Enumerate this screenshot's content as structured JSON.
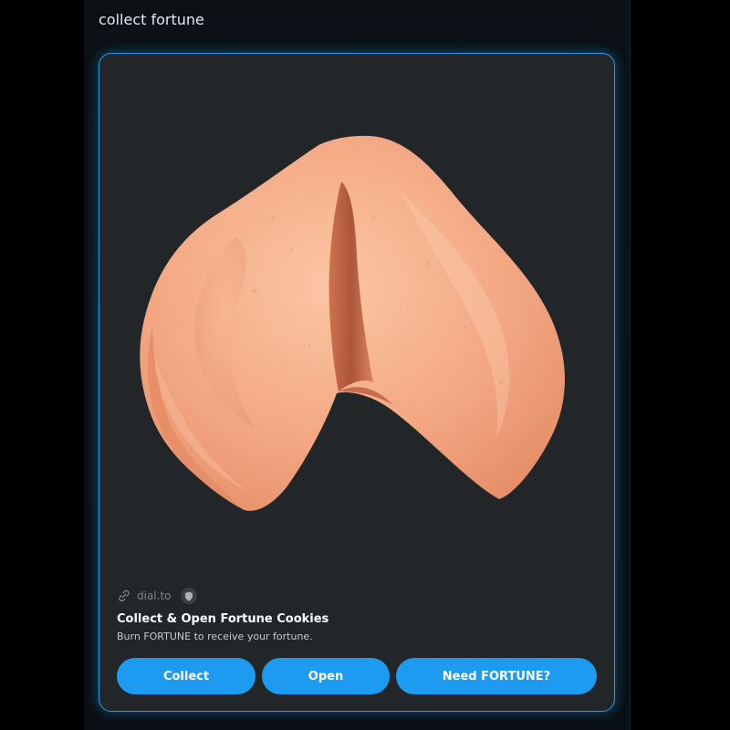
{
  "post": {
    "text": "collect fortune"
  },
  "card": {
    "domain": "dial.to",
    "title": "Collect & Open Fortune Cookies",
    "description": "Burn FORTUNE to receive your fortune.",
    "buttons": [
      {
        "label": "Collect"
      },
      {
        "label": "Open"
      },
      {
        "label": "Need FORTUNE?"
      }
    ],
    "icons": {
      "link": "link-icon",
      "verified": "shield-icon"
    },
    "colors": {
      "accent": "#1d9bf0",
      "card_bg": "#232629",
      "page_bg": "#000000"
    }
  }
}
